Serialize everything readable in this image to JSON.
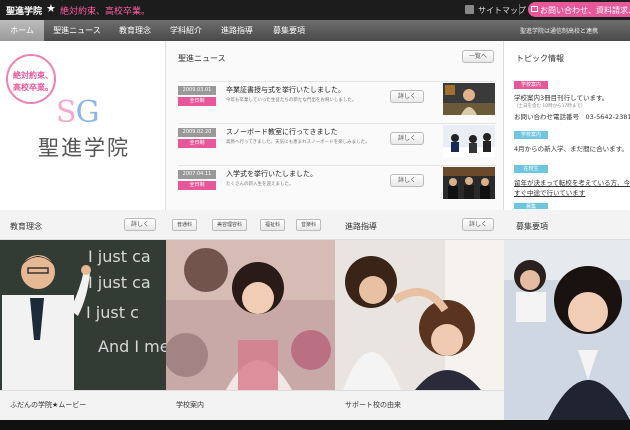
{
  "topbar": {
    "brand": "聖進学院",
    "slogan": "絶対約束、高校卒業。",
    "sitemap": "サイトマップ",
    "contact": "お問い合わせ、資料請求、お"
  },
  "nav": {
    "items": [
      "ホーム",
      "聖進ニュース",
      "教育理念",
      "学科紹介",
      "進路指導",
      "募集要項"
    ],
    "note": "聖進学院は通信制高校と連携"
  },
  "logo": {
    "bubble_line1": "絶対約束、",
    "bubble_line2": "高校卒業。",
    "s": "S",
    "g": "G",
    "name": "聖進学院"
  },
  "news": {
    "title": "聖進ニュース",
    "more": "一覧へ",
    "items": [
      {
        "date": "2009.03.01",
        "cat": "全日制",
        "title": "卒業証書授与式を挙行いたしました。",
        "body": "今年も卒業していった生徒たちの新たな門出をお祝いしました。",
        "more": "詳しく"
      },
      {
        "date": "2009.02.20",
        "cat": "全日制",
        "title": "スノーボード教室に行ってきました",
        "body": "高原へ行ってきました。天気にも恵まれスノーボードを楽しみました。",
        "more": "詳しく"
      },
      {
        "date": "2007.04.11",
        "cat": "全日制",
        "title": "入学式を挙行いたしました。",
        "body": "たくさんの新入生を迎えました。",
        "more": "詳しく"
      }
    ]
  },
  "topics": {
    "title": "トピック情報",
    "items": [
      {
        "cat": "学校案内",
        "cat_color": "#e7589b",
        "text": "学校案内3冊目刊行しています。",
        "sub": "（土日を含む 10時から17時まで）",
        "text2": "お問い合わせ電話番号　03-5642-2381"
      },
      {
        "cat": "学校案内",
        "cat_color": "#6ec6df",
        "text": "4月からの新入学、まだ間に合います。"
      },
      {
        "cat": "在校生",
        "cat_color": "#6ec6df",
        "text": "留年が決まって転校を考えている方、今",
        "text2": "すぐ中途で行いています"
      },
      {
        "cat": "募集",
        "cat_color": "#6ec6df"
      }
    ]
  },
  "bottom": {
    "col1": {
      "title": "教育理念",
      "more": "詳しく",
      "footer": "ふだんの学院★ムービー"
    },
    "col2": {
      "tabs": [
        "普通科",
        "美容理容科",
        "福祉科",
        "音楽科"
      ],
      "footer": "学校案内"
    },
    "col3": {
      "title": "進路指導",
      "more": "詳しく",
      "footer": "サポート校の由来"
    },
    "col4": {
      "title": "募集要項"
    },
    "board": [
      "I just ca",
      "I just ca",
      "I just c",
      "And I me"
    ]
  }
}
